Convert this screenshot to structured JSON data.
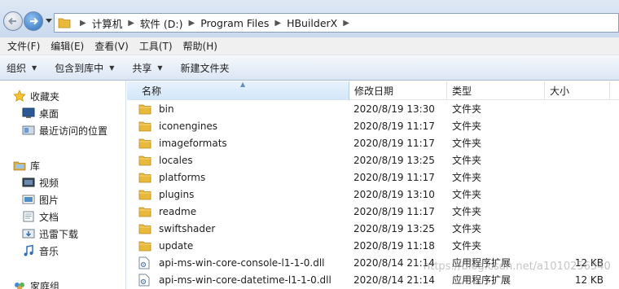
{
  "address": {
    "crumbs": [
      "计算机",
      "软件 (D:)",
      "Program Files",
      "HBuilderX"
    ]
  },
  "menu": [
    "文件(F)",
    "编辑(E)",
    "查看(V)",
    "工具(T)",
    "帮助(H)"
  ],
  "toolbar": {
    "organize": "组织",
    "include_in_library": "包含到库中",
    "share": "共享",
    "new_folder": "新建文件夹"
  },
  "nav": {
    "favorites": "收藏夹",
    "desktop": "桌面",
    "recent": "最近访问的位置",
    "libraries": "库",
    "videos": "视频",
    "pictures": "图片",
    "documents": "文档",
    "thunder": "迅雷下载",
    "music": "音乐",
    "homegroup": "家庭组"
  },
  "columns": {
    "name": "名称",
    "date": "修改日期",
    "type": "类型",
    "size": "大小"
  },
  "files": [
    {
      "name": "bin",
      "date": "2020/8/19 13:30",
      "type": "文件夹",
      "size": "",
      "kind": "folder"
    },
    {
      "name": "iconengines",
      "date": "2020/8/19 11:17",
      "type": "文件夹",
      "size": "",
      "kind": "folder"
    },
    {
      "name": "imageformats",
      "date": "2020/8/19 11:17",
      "type": "文件夹",
      "size": "",
      "kind": "folder"
    },
    {
      "name": "locales",
      "date": "2020/8/19 13:25",
      "type": "文件夹",
      "size": "",
      "kind": "folder"
    },
    {
      "name": "platforms",
      "date": "2020/8/19 11:17",
      "type": "文件夹",
      "size": "",
      "kind": "folder"
    },
    {
      "name": "plugins",
      "date": "2020/8/19 13:10",
      "type": "文件夹",
      "size": "",
      "kind": "folder"
    },
    {
      "name": "readme",
      "date": "2020/8/19 11:17",
      "type": "文件夹",
      "size": "",
      "kind": "folder"
    },
    {
      "name": "swiftshader",
      "date": "2020/8/19 13:25",
      "type": "文件夹",
      "size": "",
      "kind": "folder"
    },
    {
      "name": "update",
      "date": "2020/8/19 11:18",
      "type": "文件夹",
      "size": "",
      "kind": "folder"
    },
    {
      "name": "api-ms-win-core-console-l1-1-0.dll",
      "date": "2020/8/14 21:14",
      "type": "应用程序扩展",
      "size": "12 KB",
      "kind": "dll"
    },
    {
      "name": "api-ms-win-core-datetime-l1-1-0.dll",
      "date": "2020/8/14 21:14",
      "type": "应用程序扩展",
      "size": "12 KB",
      "kind": "dll"
    }
  ],
  "watermark": "https://blog.csdn.net/a1010256340",
  "icons": {
    "back": "back-arrow-icon",
    "forward": "forward-arrow-icon",
    "folder": "folder-icon",
    "dll": "dll-file-icon",
    "star": "star-icon"
  },
  "colors": {
    "folder": "#e8b93a",
    "accent": "#2d6fb9",
    "selected_header": "#d3e6f8"
  }
}
